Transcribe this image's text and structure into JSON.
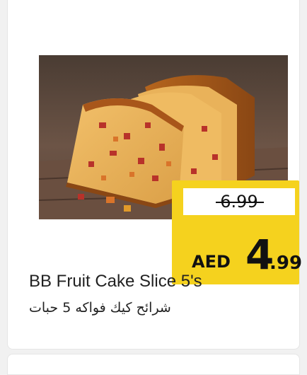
{
  "product": {
    "name_en": "BB Fruit Cake Slice 5's",
    "name_ar": "شرائح كيك فواكه 5 حبات",
    "image_alt": "fruit cake slices"
  },
  "price": {
    "old": "6.99",
    "currency": "AED",
    "new_int": "4",
    "new_dec": ".99"
  },
  "colors": {
    "tag_yellow": "#f5d21e",
    "text": "#111111"
  }
}
